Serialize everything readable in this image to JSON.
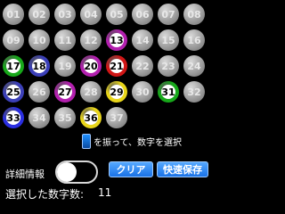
{
  "balls": [
    {
      "label": "01",
      "selected": false,
      "color": ""
    },
    {
      "label": "02",
      "selected": false,
      "color": ""
    },
    {
      "label": "03",
      "selected": false,
      "color": ""
    },
    {
      "label": "04",
      "selected": false,
      "color": ""
    },
    {
      "label": "05",
      "selected": false,
      "color": ""
    },
    {
      "label": "06",
      "selected": false,
      "color": ""
    },
    {
      "label": "07",
      "selected": false,
      "color": ""
    },
    {
      "label": "08",
      "selected": false,
      "color": ""
    },
    {
      "label": "09",
      "selected": false,
      "color": ""
    },
    {
      "label": "10",
      "selected": false,
      "color": ""
    },
    {
      "label": "11",
      "selected": false,
      "color": ""
    },
    {
      "label": "12",
      "selected": false,
      "color": ""
    },
    {
      "label": "13",
      "selected": true,
      "color": "#b21fae"
    },
    {
      "label": "14",
      "selected": false,
      "color": ""
    },
    {
      "label": "15",
      "selected": false,
      "color": ""
    },
    {
      "label": "16",
      "selected": false,
      "color": ""
    },
    {
      "label": "17",
      "selected": true,
      "color": "#17a81a"
    },
    {
      "label": "18",
      "selected": true,
      "color": "#3b3fb8"
    },
    {
      "label": "19",
      "selected": false,
      "color": ""
    },
    {
      "label": "20",
      "selected": true,
      "color": "#b21fae"
    },
    {
      "label": "21",
      "selected": true,
      "color": "#d01616"
    },
    {
      "label": "22",
      "selected": false,
      "color": ""
    },
    {
      "label": "23",
      "selected": false,
      "color": ""
    },
    {
      "label": "24",
      "selected": false,
      "color": ""
    },
    {
      "label": "25",
      "selected": true,
      "color": "#3b3fb8"
    },
    {
      "label": "26",
      "selected": false,
      "color": ""
    },
    {
      "label": "27",
      "selected": true,
      "color": "#b21fae"
    },
    {
      "label": "28",
      "selected": false,
      "color": ""
    },
    {
      "label": "29",
      "selected": true,
      "color": "#e8d51a"
    },
    {
      "label": "30",
      "selected": false,
      "color": ""
    },
    {
      "label": "31",
      "selected": true,
      "color": "#17a81a"
    },
    {
      "label": "32",
      "selected": false,
      "color": ""
    },
    {
      "label": "33",
      "selected": true,
      "color": "#2a2ee0"
    },
    {
      "label": "34",
      "selected": false,
      "color": ""
    },
    {
      "label": "35",
      "selected": false,
      "color": ""
    },
    {
      "label": "36",
      "selected": true,
      "color": "#e8d51a"
    },
    {
      "label": "37",
      "selected": false,
      "color": ""
    }
  ],
  "hint": {
    "icon": "phone-icon",
    "text": "を振って、数字を選択"
  },
  "detail": {
    "label": "詳細情報",
    "enabled": false
  },
  "buttons": {
    "clear": "クリア",
    "save": "快速保存"
  },
  "count": {
    "label": "選択した数字数:",
    "value": "11"
  },
  "colors": {
    "button": "#1a72e6",
    "background": "#000000"
  }
}
